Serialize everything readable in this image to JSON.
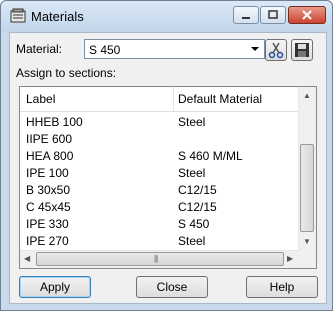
{
  "window": {
    "title": "Materials"
  },
  "material": {
    "label": "Material:",
    "value": "S 450"
  },
  "assign": {
    "label": "Assign to sections:"
  },
  "columns": {
    "label": "Label",
    "material": "Default Material"
  },
  "rows": [
    {
      "label": "HHEB 100",
      "material": "Steel"
    },
    {
      "label": "IIPE 600",
      "material": ""
    },
    {
      "label": "HEA 800",
      "material": "S 460  M/ML"
    },
    {
      "label": "IPE 100",
      "material": "Steel"
    },
    {
      "label": "B 30x50",
      "material": "C12/15"
    },
    {
      "label": "C 45x45",
      "material": "C12/15"
    },
    {
      "label": "IPE 330",
      "material": "S 450"
    },
    {
      "label": "IPE 270",
      "material": "Steel"
    }
  ],
  "buttons": {
    "apply": "Apply",
    "close": "Close",
    "help": "Help"
  },
  "icons": {
    "title": "materials-icon",
    "edit": "scissors-icon",
    "save": "save-disk-icon"
  }
}
